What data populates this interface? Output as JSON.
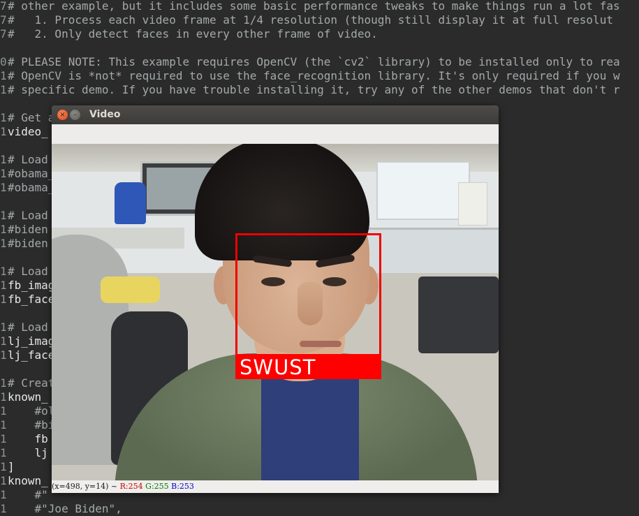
{
  "editor": {
    "lines": [
      {
        "num": "7",
        "text": "# other example, but it includes some basic performance tweaks to make things run a lot fas",
        "kind": "comment"
      },
      {
        "num": "7",
        "text": "#   1. Process each video frame at 1/4 resolution (though still display it at full resolut",
        "kind": "comment"
      },
      {
        "num": "7",
        "text": "#   2. Only detect faces in every other frame of video.",
        "kind": "comment"
      },
      {
        "num": "",
        "text": "",
        "kind": "comment"
      },
      {
        "num": "0",
        "text": "# PLEASE NOTE: This example requires OpenCV (the `cv2` library) to be installed only to rea",
        "kind": "comment"
      },
      {
        "num": "1",
        "text": "# OpenCV is *not* required to use the face_recognition library. It's only required if you w",
        "kind": "comment"
      },
      {
        "num": "1",
        "text": "# specific demo. If you have trouble installing it, try any of the other demos that don't r",
        "kind": "comment"
      },
      {
        "num": "",
        "text": "",
        "kind": "comment"
      },
      {
        "num": "1",
        "text": "# Get a",
        "kind": "comment"
      },
      {
        "num": "1",
        "text": "video_",
        "kind": "plain"
      },
      {
        "num": "",
        "text": "",
        "kind": "comment"
      },
      {
        "num": "1",
        "text": "# Load",
        "kind": "comment"
      },
      {
        "num": "1",
        "text": "#obama_",
        "kind": "comment"
      },
      {
        "num": "1",
        "text": "#obama_",
        "kind": "comment"
      },
      {
        "num": "",
        "text": "",
        "kind": "comment"
      },
      {
        "num": "1",
        "text": "# Load",
        "kind": "comment"
      },
      {
        "num": "1",
        "text": "#biden",
        "kind": "comment"
      },
      {
        "num": "1",
        "text": "#biden",
        "kind": "comment"
      },
      {
        "num": "",
        "text": "",
        "kind": "comment"
      },
      {
        "num": "1",
        "text": "# Load",
        "kind": "comment"
      },
      {
        "num": "1",
        "text": "fb_imag",
        "kind": "plain"
      },
      {
        "num": "1",
        "text": "fb_face",
        "kind": "plain"
      },
      {
        "num": "",
        "text": "",
        "kind": "comment"
      },
      {
        "num": "1",
        "text": "# Load",
        "kind": "comment"
      },
      {
        "num": "1",
        "text": "lj_imag",
        "kind": "plain"
      },
      {
        "num": "1",
        "text": "lj_face",
        "kind": "plain"
      },
      {
        "num": "",
        "text": "",
        "kind": "comment"
      },
      {
        "num": "1",
        "text": "# Creat",
        "kind": "comment"
      },
      {
        "num": "1",
        "text": "known_",
        "kind": "plain"
      },
      {
        "num": "1",
        "text": "    #ol",
        "kind": "comment"
      },
      {
        "num": "1",
        "text": "    #bi",
        "kind": "comment"
      },
      {
        "num": "1",
        "text": "    fb",
        "kind": "plain"
      },
      {
        "num": "1",
        "text": "    lj",
        "kind": "plain"
      },
      {
        "num": "1",
        "text": "]",
        "kind": "plain"
      },
      {
        "num": "1",
        "text": "known_",
        "kind": "plain"
      },
      {
        "num": "1",
        "text": "    #\"",
        "kind": "comment"
      },
      {
        "num": "1",
        "text": "    #\"Joe Biden\",",
        "kind": "comment"
      }
    ]
  },
  "window": {
    "title": "Video",
    "close_glyph": "×",
    "minimize_glyph": "–"
  },
  "detection": {
    "label": "SWUST"
  },
  "statusbar": {
    "coords": "(x=498, y=14) ~",
    "r": "R:254",
    "g": "G:255",
    "b": "B:253"
  }
}
